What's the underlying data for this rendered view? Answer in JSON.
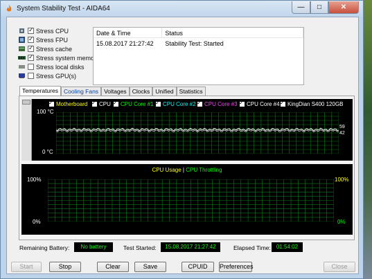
{
  "window": {
    "title": "System Stability Test - AIDA64",
    "minimize": "—",
    "maximize": "□",
    "close": "✕"
  },
  "stress": [
    {
      "label": "Stress CPU",
      "checked": true,
      "icon": "cpu-icon"
    },
    {
      "label": "Stress FPU",
      "checked": true,
      "icon": "fpu-icon"
    },
    {
      "label": "Stress cache",
      "checked": true,
      "icon": "cache-icon"
    },
    {
      "label": "Stress system memory",
      "checked": true,
      "icon": "memory-icon"
    },
    {
      "label": "Stress local disks",
      "checked": false,
      "icon": "disk-icon"
    },
    {
      "label": "Stress GPU(s)",
      "checked": false,
      "icon": "gpu-icon"
    }
  ],
  "log": {
    "col_date": "Date & Time",
    "col_status": "Status",
    "rows": [
      {
        "date": "15.08.2017 21:27:42",
        "status": "Stability Test: Started"
      }
    ]
  },
  "tabs": [
    "Temperatures",
    "Cooling Fans",
    "Voltages",
    "Clocks",
    "Unified",
    "Statistics"
  ],
  "temp_chart": {
    "legend": [
      {
        "label": "Motherboard",
        "color": "#ffff00"
      },
      {
        "label": "CPU",
        "color": "#ffffff"
      },
      {
        "label": "CPU Core #1",
        "color": "#00ff00"
      },
      {
        "label": "CPU Core #2",
        "color": "#00ffff"
      },
      {
        "label": "CPU Core #3",
        "color": "#ff40ff"
      },
      {
        "label": "CPU Core #4",
        "color": "#ffffff"
      },
      {
        "label": "KingDian S400 120GB",
        "color": "#ffffff"
      }
    ],
    "y_max": "100 °C",
    "y_min": "0 °C",
    "value_59": "59",
    "value_42": "42",
    "line_color": "#ffffff"
  },
  "usage_chart": {
    "title_usage": "CPU Usage",
    "title_sep": "|",
    "title_throttle": "CPU Throttling",
    "left_top": "100%",
    "left_bottom": "0%",
    "right_top": "100%",
    "right_bottom": "0%",
    "grid_color": "#0a7a1a"
  },
  "stats": {
    "battery_label": "Remaining Battery:",
    "battery_value": "No battery",
    "started_label": "Test Started:",
    "started_value": "15.08.2017 21:27:42",
    "elapsed_label": "Elapsed Time:",
    "elapsed_value": "01:54:02"
  },
  "buttons": {
    "start": "Start",
    "stop": "Stop",
    "clear": "Clear",
    "save": "Save",
    "cpuid": "CPUID",
    "preferences": "Preferences",
    "close": "Close"
  }
}
